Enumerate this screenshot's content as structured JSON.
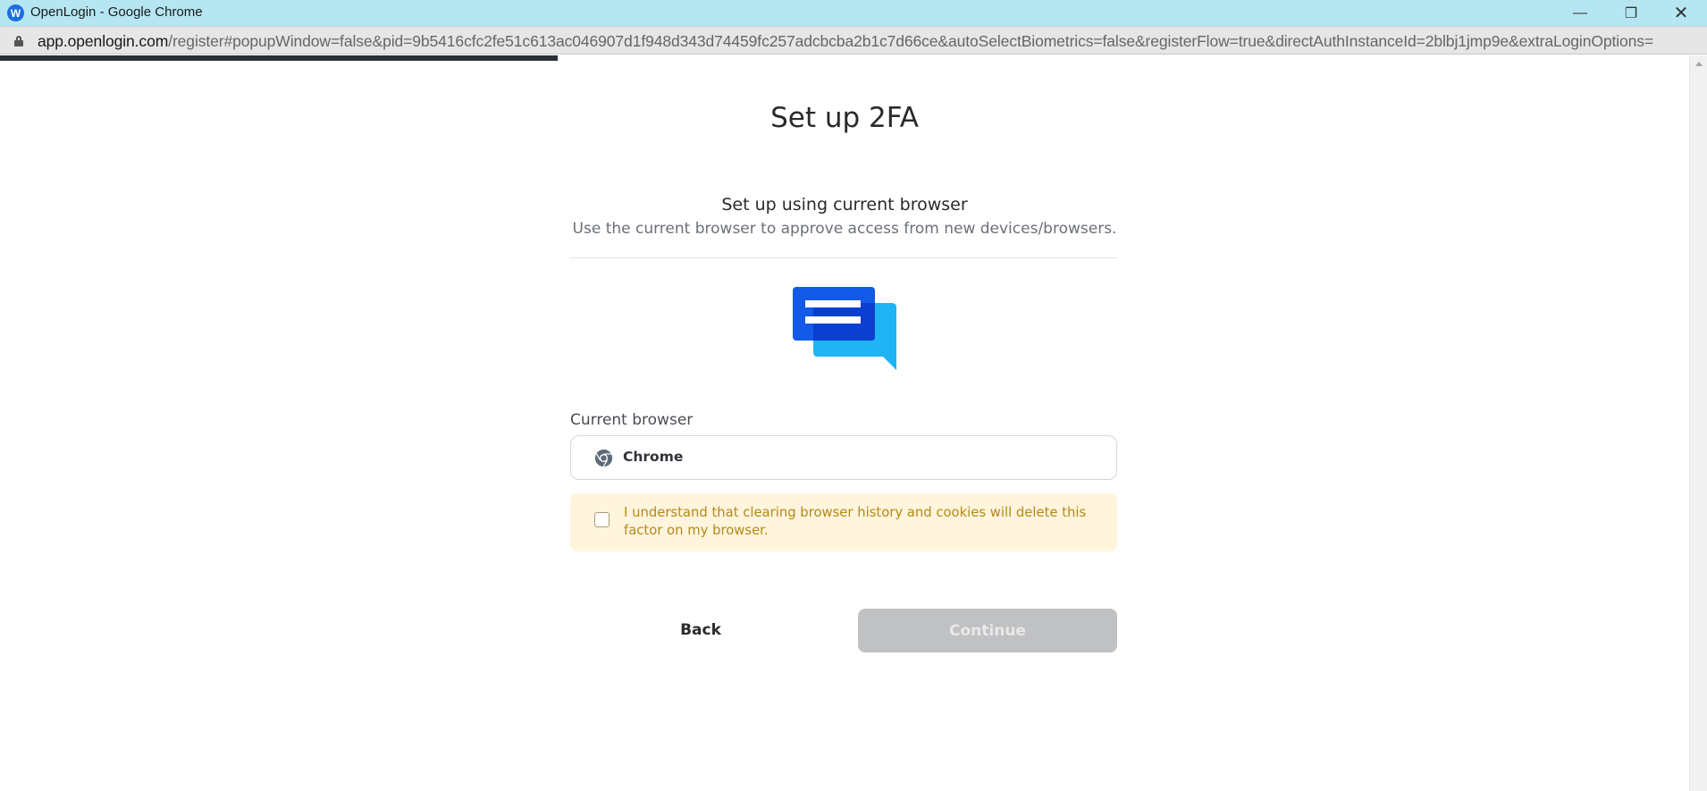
{
  "window": {
    "title": "OpenLogin - Google Chrome",
    "app_icon_letter": "W",
    "minimize_glyph": "—",
    "maximize_glyph": "❐",
    "close_glyph": "✕"
  },
  "addressbar": {
    "host": "app.openlogin.com",
    "path": "/register#popupWindow=false&pid=9b5416cfc2fe51c613ac046907d1f948d343d74459fc257adcbcba2b1c7d66ce&autoSelectBiometrics=false&registerFlow=true&directAuthInstanceId=2blbj1jmp9e&extraLoginOptions="
  },
  "page_load_progress": 0.33,
  "main": {
    "title": "Set up 2FA",
    "section_title": "Set up using current browser",
    "section_description": "Use the current browser to approve access from new devices/browsers.",
    "icon": "chat-bubbles-icon",
    "field_label": "Current browser",
    "browser_value": "Chrome",
    "browser_icon": "chrome-icon",
    "warning": {
      "checked": false,
      "text": "I understand that clearing browser history and cookies will delete this factor on my browser."
    },
    "back_label": "Back",
    "continue_label": "Continue"
  },
  "colors": {
    "titlebar": "#b5e6f2",
    "warning_bg": "#fff4dc",
    "warning_text": "#b48a17",
    "continue_disabled": "#c0c1c3",
    "icon_dark_blue": "#0a55e6",
    "icon_light_blue": "#1fb4f5"
  }
}
